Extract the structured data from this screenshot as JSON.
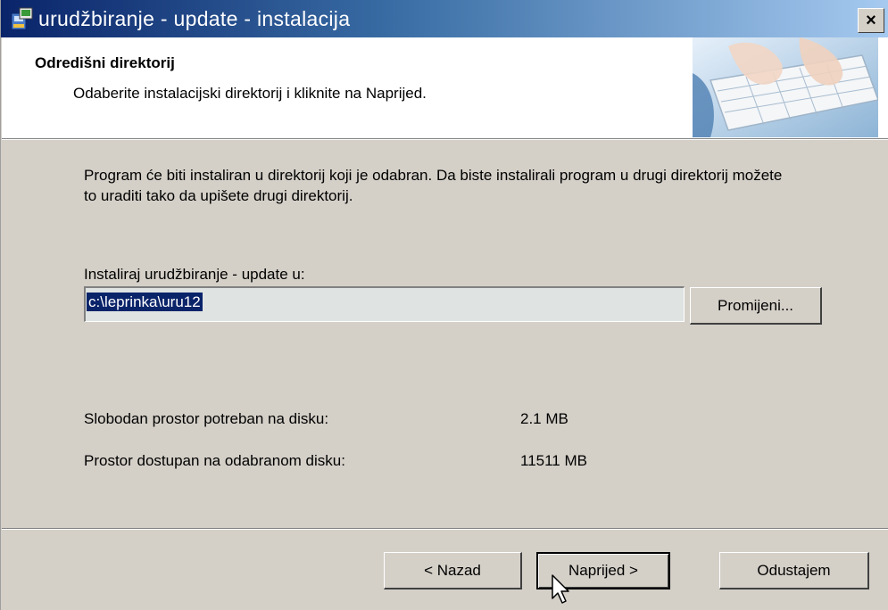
{
  "window": {
    "title": "urudžbiranje - update - instalacija",
    "close_label": "×"
  },
  "header": {
    "title": "Odredišni direktorij",
    "subtitle": "Odaberite instalacijski direktorij i kliknite na Naprijed."
  },
  "body": {
    "description": "Program će biti instaliran u direktorij koji je odabran. Da biste instalirali program u drugi direktorij možete to uraditi tako da upišete drugi direktorij.",
    "install_label": "Instaliraj urudžbiranje - update u:",
    "install_path": "c:\\leprinka\\uru12",
    "change_button": "Promijeni...",
    "space_required_label": "Slobodan prostor potreban na disku:",
    "space_required_value": "2.1 MB",
    "space_available_label": "Prostor dostupan na odabranom disku:",
    "space_available_value": "11511 MB"
  },
  "footer": {
    "back_button": "< Nazad",
    "next_button": "Naprijed >",
    "cancel_button": "Odustajem"
  },
  "colors": {
    "title_bar_start": "#0a246a",
    "title_bar_end": "#a6caf0",
    "dialog_bg": "#d4d0c8",
    "selection_bg": "#0a246a"
  },
  "icons": {
    "app": "installer-icon",
    "header_image": "keyboard-hands-image",
    "cursor": "mouse-pointer-icon"
  }
}
